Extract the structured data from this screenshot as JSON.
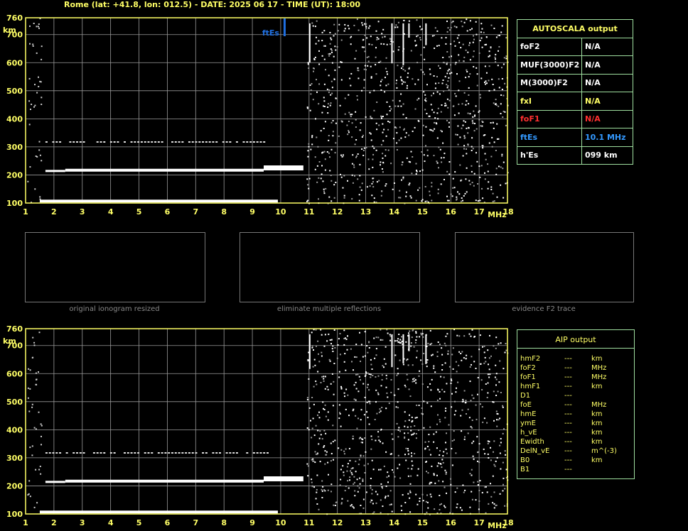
{
  "header": "Rome (lat: +41.8, lon: 012.5) - DATE: 2025 06 17 - TIME (UT): 18:00",
  "chart_data": [
    {
      "type": "scatter",
      "title": "",
      "xlabel": "MHz",
      "ylabel": "km",
      "xlim": [
        1,
        18
      ],
      "ylim": [
        100,
        760
      ],
      "x_ticks": [
        "1",
        "2",
        "3",
        "4",
        "5",
        "6",
        "7",
        "8",
        "9",
        "10",
        "11",
        "12",
        "13",
        "14",
        "15",
        "16",
        "17",
        "18"
      ],
      "y_ticks": [
        "100",
        "200",
        "300",
        "400",
        "500",
        "600",
        "700",
        "760"
      ],
      "grid": true,
      "annotation": {
        "label": "ftEs",
        "x": 10.1
      },
      "traces": [
        {
          "name": "",
          "x": [
            1.5,
            9.9
          ],
          "y": [
            110,
            110
          ]
        },
        {
          "name": "",
          "x": [
            1.7,
            10.2
          ],
          "y": [
            215,
            228
          ]
        },
        {
          "name": "",
          "x": [
            1.7,
            9.6
          ],
          "y": [
            318,
            318
          ]
        }
      ]
    },
    {
      "type": "scatter",
      "title": "",
      "xlabel": "MHz",
      "ylabel": "km",
      "xlim": [
        1,
        18
      ],
      "ylim": [
        100,
        760
      ],
      "x_ticks": [
        "1",
        "2",
        "3",
        "4",
        "5",
        "6",
        "7",
        "8",
        "9",
        "10",
        "11",
        "12",
        "13",
        "14",
        "15",
        "16",
        "17",
        "18"
      ],
      "y_ticks": [
        "100",
        "200",
        "300",
        "400",
        "500",
        "600",
        "700",
        "760"
      ],
      "grid": true
    }
  ],
  "autoscala": {
    "title": "AUTOSCALA output",
    "rows": [
      {
        "label": "foF2",
        "value": "N/A",
        "color": "#ffffff"
      },
      {
        "label": "MUF(3000)F2",
        "value": "N/A",
        "color": "#ffffff"
      },
      {
        "label": "M(3000)F2",
        "value": "N/A",
        "color": "#ffffff"
      },
      {
        "label": "fxI",
        "value": "N/A",
        "color": "#ffff66"
      },
      {
        "label": "foF1",
        "value": "N/A",
        "color": "#ff3030"
      },
      {
        "label": "ftEs",
        "value": "10.1 MHz",
        "color": "#3399ff"
      },
      {
        "label": "h'Es",
        "value": "099     km",
        "color": "#ffffff"
      }
    ]
  },
  "thumbnails": [
    {
      "caption": "original ionogram resized"
    },
    {
      "caption": "eliminate multiple reflections"
    },
    {
      "caption": "evidence F2 trace"
    }
  ],
  "aip": {
    "title": "AIP output",
    "rows": [
      {
        "name": "hmF2",
        "value": "---",
        "unit": "km"
      },
      {
        "name": "foF2",
        "value": "---",
        "unit": "MHz"
      },
      {
        "name": "foF1",
        "value": "---",
        "unit": "MHz"
      },
      {
        "name": "hmF1",
        "value": "---",
        "unit": "km"
      },
      {
        "name": "D1",
        "value": "---",
        "unit": ""
      },
      {
        "name": "foE",
        "value": "---",
        "unit": "MHz"
      },
      {
        "name": "hmE",
        "value": "---",
        "unit": "km"
      },
      {
        "name": "ymE",
        "value": "---",
        "unit": "km"
      },
      {
        "name": "h_vE",
        "value": "---",
        "unit": "km"
      },
      {
        "name": "Ewidth",
        "value": "---",
        "unit": "km"
      },
      {
        "name": "DelN_vE",
        "value": "---",
        "unit": "m^(-3)"
      },
      {
        "name": "B0",
        "value": "---",
        "unit": "km"
      },
      {
        "name": "B1",
        "value": "---",
        "unit": ""
      }
    ]
  },
  "colors": {
    "axis": "#ffff66",
    "grid": "#9a9a9a",
    "trace": "#ffffff",
    "marker": "#1f6fe0",
    "border": "#9fdf9f"
  }
}
